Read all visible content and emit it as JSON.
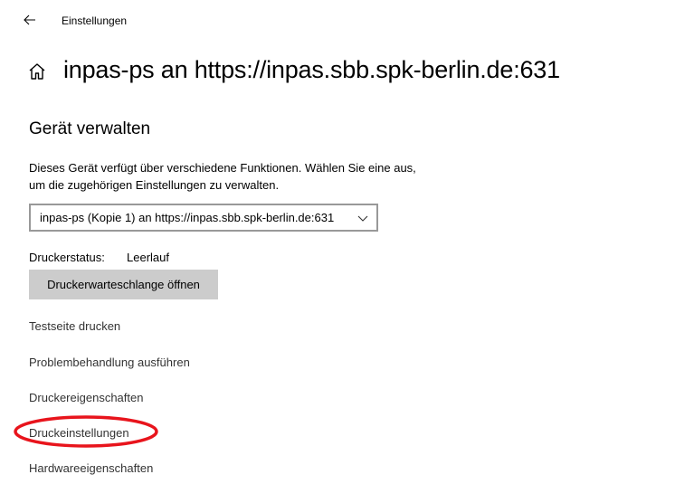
{
  "window": {
    "title": "Einstellungen",
    "back_icon": "back-arrow-icon"
  },
  "header": {
    "home_icon": "home-icon",
    "title": "inpas-ps an https://inpas.sbb.spk-berlin.de:631"
  },
  "manage": {
    "section_title": "Gerät verwalten",
    "description_line1": "Dieses Gerät verfügt über verschiedene Funktionen. Wählen Sie eine aus,",
    "description_line2": "um die zugehörigen Einstellungen zu verwalten.",
    "device_select": {
      "selected": "inpas-ps (Kopie 1) an https://inpas.sbb.spk-berlin.de:631",
      "chevron_icon": "chevron-down-icon"
    },
    "status": {
      "label": "Druckerstatus:",
      "value": "Leerlauf"
    },
    "queue_button": "Druckerwarteschlange öffnen",
    "links": [
      {
        "label": "Testseite drucken"
      },
      {
        "label": "Problembehandlung ausführen"
      },
      {
        "label": "Druckereigenschaften"
      },
      {
        "label": "Druckeinstellungen",
        "highlighted": true
      },
      {
        "label": "Hardwareeigenschaften"
      }
    ]
  },
  "colors": {
    "annotation": "#e8141c",
    "button_bg": "#cccccc",
    "dropdown_border": "#999999",
    "link_text": "#333333"
  }
}
